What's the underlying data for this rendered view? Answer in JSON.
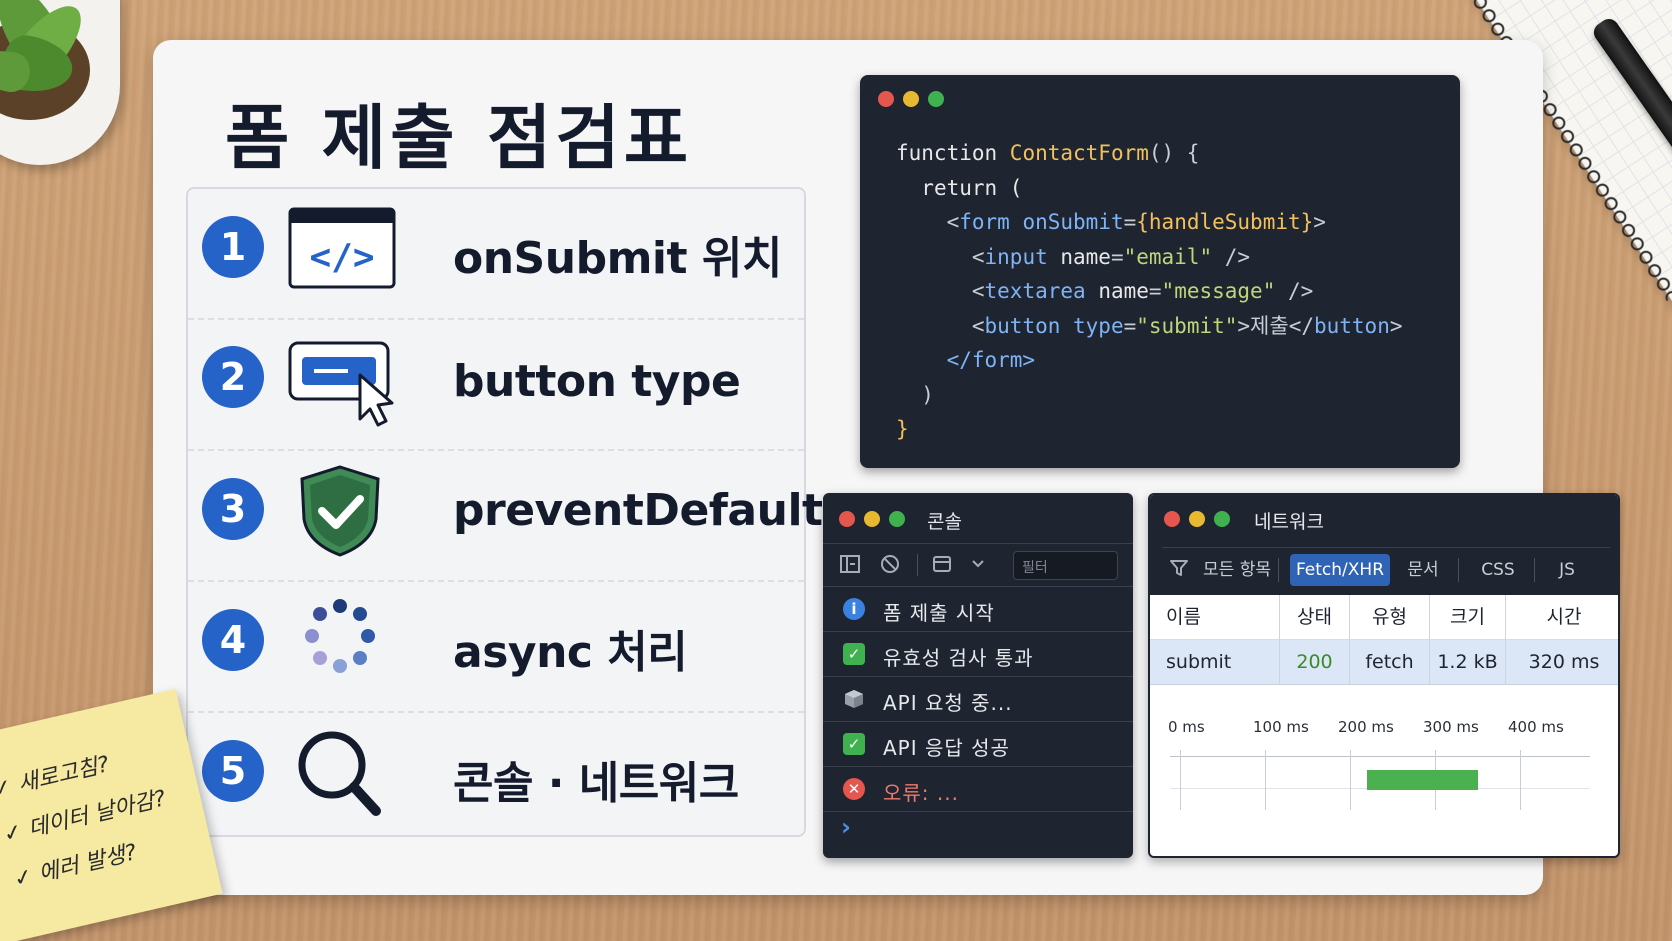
{
  "title": "폼 제출 점검표",
  "checklist": [
    {
      "number": "1",
      "label": "onSubmit 위치",
      "icon": "code-window-icon"
    },
    {
      "number": "2",
      "label": "button type",
      "icon": "button-click-icon"
    },
    {
      "number": "3",
      "label": "preventDefault",
      "icon": "shield-check-icon"
    },
    {
      "number": "4",
      "label": "async 처리",
      "icon": "loading-spinner-icon"
    },
    {
      "number": "5",
      "label": "콘솔 · 네트워크",
      "icon": "magnifier-icon"
    }
  ],
  "code": {
    "l1_kw": "function ",
    "l1_fn": "ContactForm",
    "l1_rest": "() {",
    "l2": "return (",
    "l3_open": "<",
    "l3_tag": "form",
    "l3_attr": " onSubmit",
    "l3_eq": "=",
    "l3_val": "{handleSubmit}",
    "l3_close": ">",
    "l4_tag": "input",
    "l4_attr": " name",
    "l4_val": "\"email\"",
    "l4_close": " />",
    "l5_tag": "textarea",
    "l5_attr": " name",
    "l5_val": "\"message\"",
    "l5_close": " />",
    "l6_tag": "button",
    "l6_attr": " type",
    "l6_val": "\"submit\"",
    "l6_text": ">제출</",
    "l6_endtag": "button",
    "l6_close": ">",
    "l7": "</form>",
    "l8": ")",
    "l9": "}"
  },
  "console": {
    "title": "콘솔",
    "filter_placeholder": "필터",
    "logs": [
      {
        "type": "info",
        "icon": "info-icon",
        "text": "폼 제출 시작"
      },
      {
        "type": "success",
        "icon": "check-icon",
        "text": "유효성 검사 통과"
      },
      {
        "type": "pending",
        "icon": "cube-icon",
        "text": "API 요청 중..."
      },
      {
        "type": "success",
        "icon": "check-icon",
        "text": "API 응답 성공"
      },
      {
        "type": "error",
        "icon": "error-icon",
        "text": "오류: ..."
      }
    ],
    "prompt": "›"
  },
  "network": {
    "title": "네트워크",
    "tabs": [
      "모든 항목",
      "Fetch/XHR",
      "문서",
      "CSS",
      "JS"
    ],
    "active_tab": "Fetch/XHR",
    "columns": [
      "이름",
      "상태",
      "유형",
      "크기",
      "시간"
    ],
    "rows": [
      {
        "name": "submit",
        "status": "200",
        "type": "fetch",
        "size": "1.2 kB",
        "time": "320 ms"
      }
    ],
    "timeline": {
      "ticks": [
        "0 ms",
        "100 ms",
        "200 ms",
        "300 ms",
        "400 ms"
      ],
      "bar_start_ms": 220,
      "bar_end_ms": 350,
      "bar_color": "#4bb04f"
    }
  },
  "sticky_note": [
    "✓ 새로고침?",
    "✓ 데이터 날아감?",
    "✓ 에러 발생?"
  ],
  "colors": {
    "badge": "#2563c9",
    "editor_bg": "#1e2530",
    "accent_tab": "#2f63b5"
  }
}
